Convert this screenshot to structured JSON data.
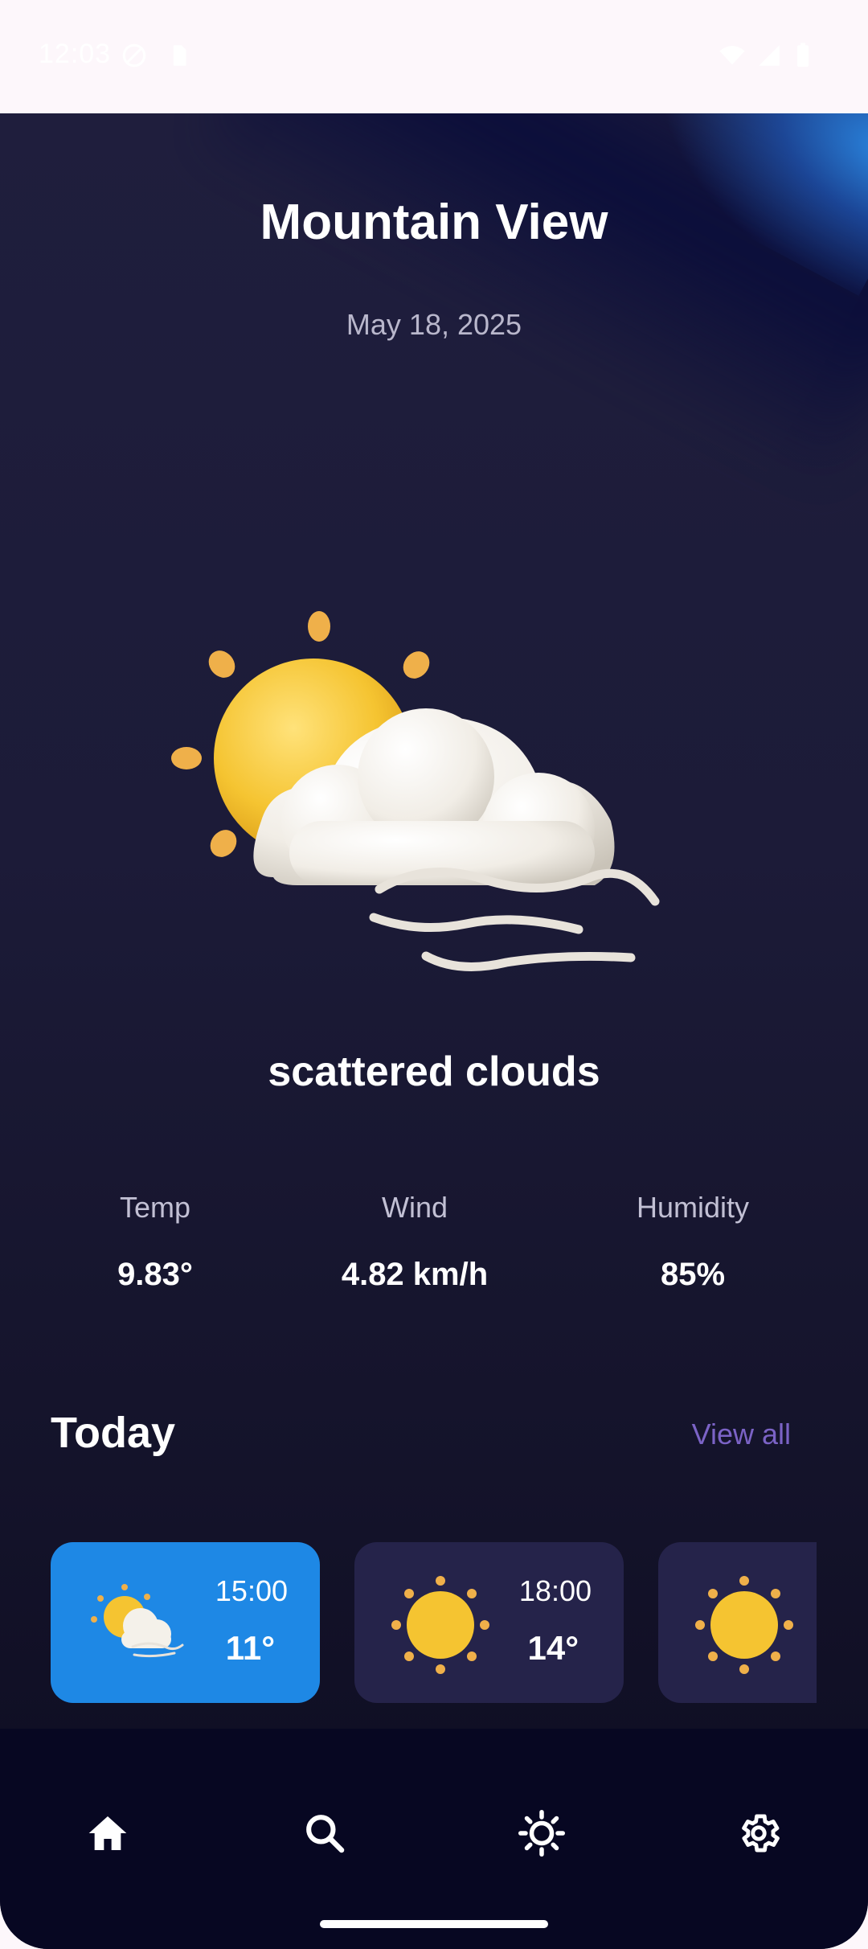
{
  "status_bar": {
    "time": "12:03"
  },
  "header": {
    "city": "Mountain View",
    "date": "May 18, 2025"
  },
  "current": {
    "icon": "sun-cloud-wind-icon",
    "description": "scattered clouds"
  },
  "stats": [
    {
      "label": "Temp",
      "value": "9.83°"
    },
    {
      "label": "Wind",
      "value": "4.82 km/h"
    },
    {
      "label": "Humidity",
      "value": "85%"
    }
  ],
  "today": {
    "title": "Today",
    "view_all_label": "View all",
    "hours": [
      {
        "time": "15:00",
        "temp": "11°",
        "icon": "sun-cloud-wind-icon",
        "active": true
      },
      {
        "time": "18:00",
        "temp": "14°",
        "icon": "sun-icon",
        "active": false
      },
      {
        "time": "",
        "temp": "",
        "icon": "sun-icon",
        "active": false
      }
    ]
  },
  "nav": {
    "items": [
      {
        "icon": "home-icon",
        "active": true
      },
      {
        "icon": "search-icon",
        "active": false
      },
      {
        "icon": "brightness-icon",
        "active": false
      },
      {
        "icon": "settings-icon",
        "active": false
      }
    ]
  },
  "colors": {
    "accent": "#1e88e5",
    "link": "#7b63c6",
    "background": "#1c1b38",
    "card": "#25234a"
  }
}
